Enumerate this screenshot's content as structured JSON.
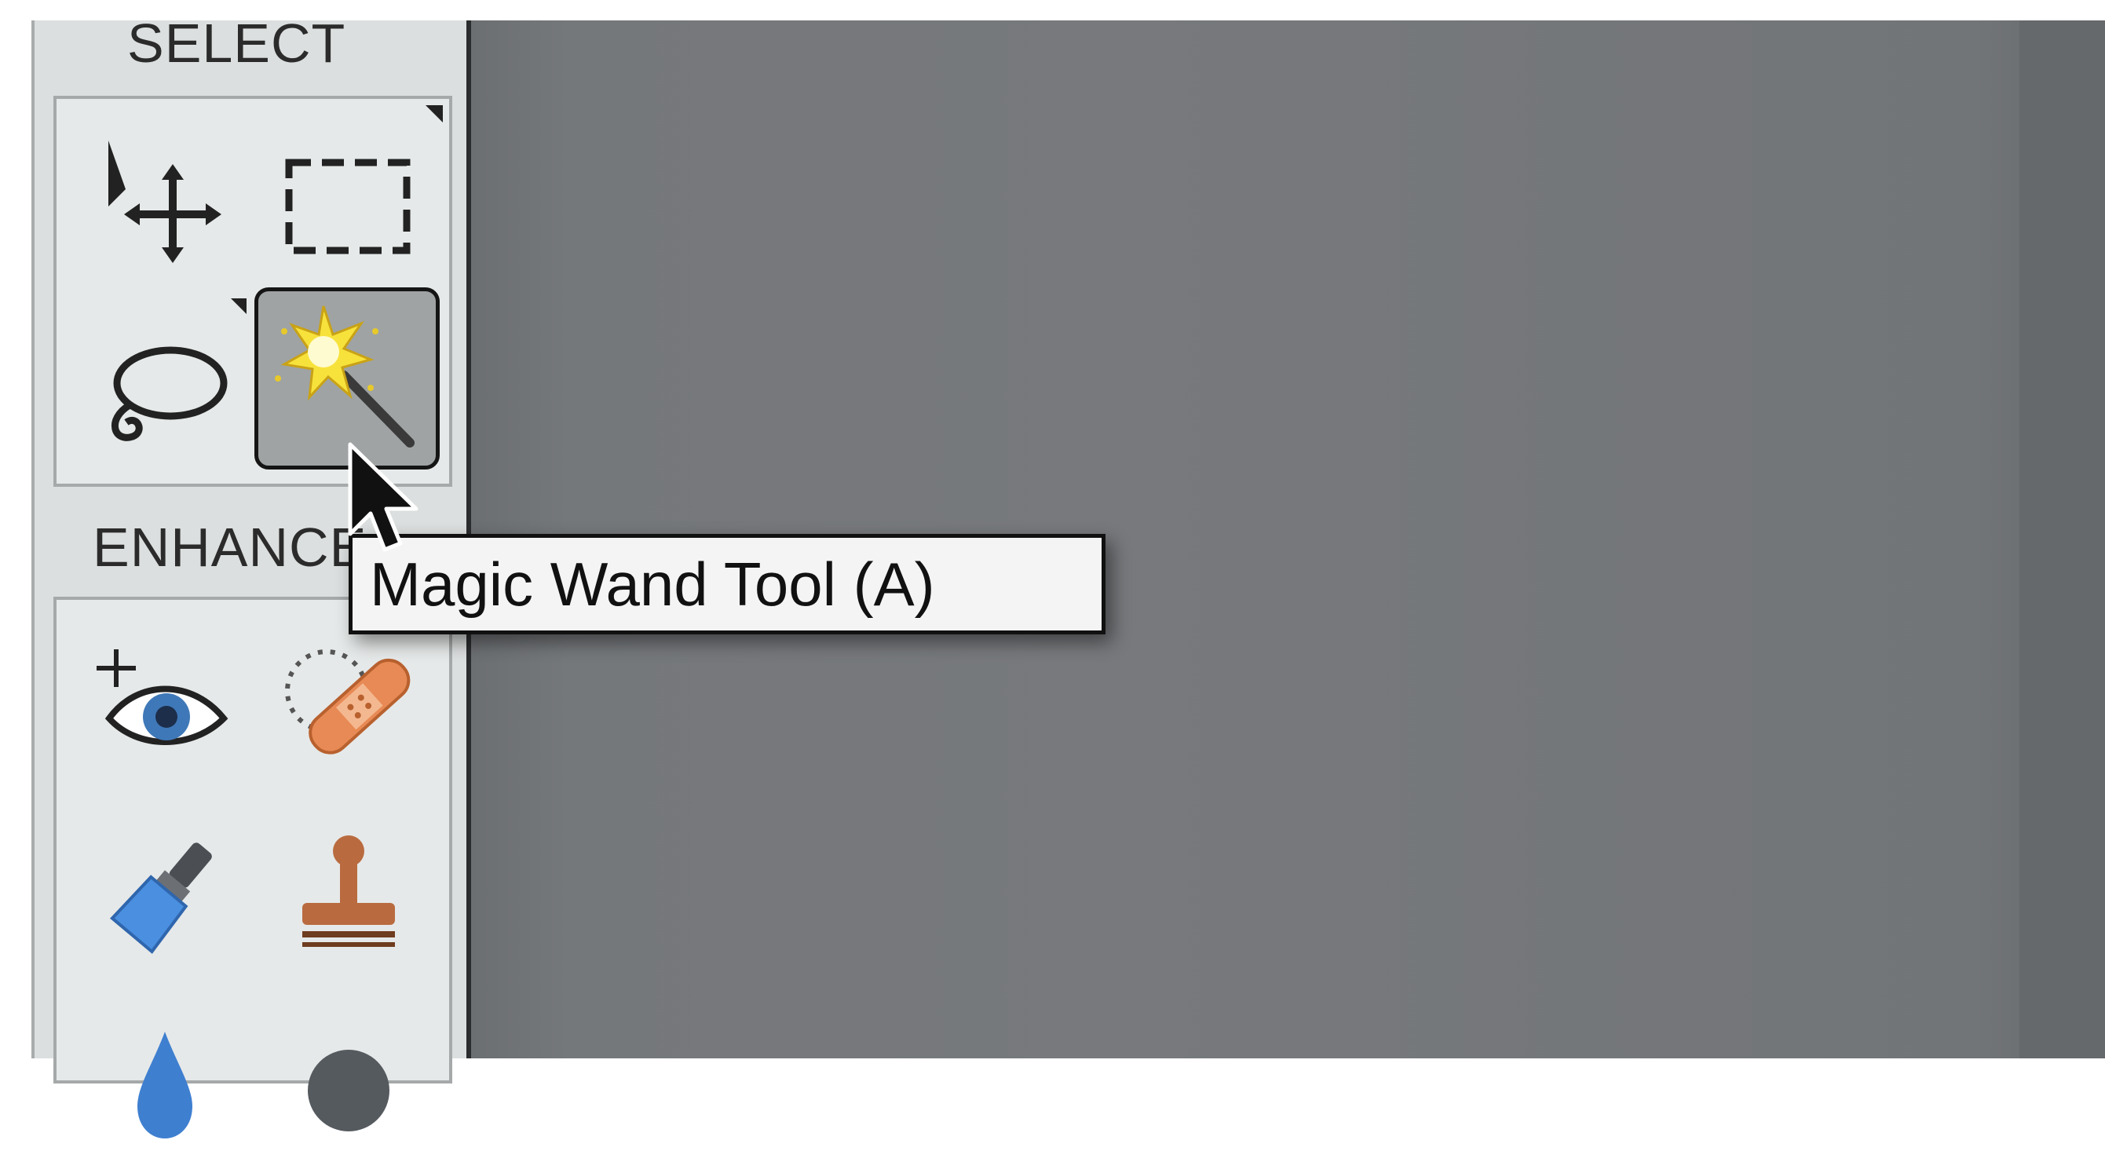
{
  "toolbox": {
    "sections": {
      "select": {
        "label": "SELECT"
      },
      "enhance": {
        "label": "ENHANCE"
      }
    },
    "tools": {
      "move": {
        "icon": "move-icon"
      },
      "marquee": {
        "icon": "rectangular-marquee-icon"
      },
      "lasso": {
        "icon": "lasso-icon"
      },
      "magic_wand": {
        "icon": "magic-wand-icon",
        "active": true
      },
      "red_eye": {
        "icon": "red-eye-removal-icon"
      },
      "spot_healing": {
        "icon": "spot-healing-brush-icon"
      },
      "smart_brush": {
        "icon": "smart-brush-icon"
      },
      "clone_stamp": {
        "icon": "clone-stamp-icon"
      },
      "blur": {
        "icon": "blur-icon"
      },
      "sponge": {
        "icon": "sponge-icon"
      }
    }
  },
  "tooltip": {
    "text": "Magic Wand Tool (A)"
  },
  "colors": {
    "panel_bg": "#dcdfdf",
    "canvas_bg": "#77797c",
    "active_tool_bg": "#9fa3a4",
    "tooltip_bg": "#f4f4f4"
  }
}
